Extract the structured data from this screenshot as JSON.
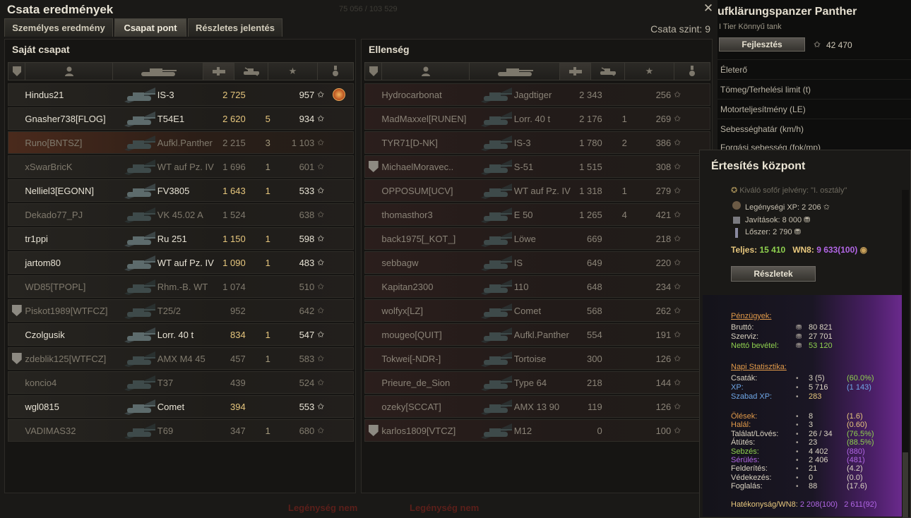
{
  "window": {
    "title": "Csata eredmények",
    "close": "✕",
    "faint_top": "75 056 / 103 529",
    "battle_level": "Csata szint: 9",
    "tabs": [
      {
        "label": "Személyes eredmény"
      },
      {
        "label": "Csapat pont"
      },
      {
        "label": "Részletes jelentés"
      }
    ]
  },
  "own_team": {
    "title": "Saját csapat",
    "rows": [
      {
        "name": "Hindus21",
        "tank": "IS-3",
        "xp": "2 725",
        "kills": "",
        "score": "957",
        "state": "alive",
        "medal": true,
        "squad": false
      },
      {
        "name": "Gnasher738[FLOG]",
        "tank": "T54E1",
        "xp": "2 620",
        "kills": "5",
        "score": "934",
        "state": "alive",
        "medal": false,
        "squad": false
      },
      {
        "name": "Runo[BNTSZ]",
        "tank": "Aufkl.Panther",
        "xp": "2 215",
        "kills": "3",
        "score": "1 103",
        "state": "me",
        "medal": false,
        "squad": false
      },
      {
        "name": "xSwarBricK",
        "tank": "WT auf Pz. IV",
        "xp": "1 696",
        "kills": "1",
        "score": "601",
        "state": "dead",
        "medal": false,
        "squad": false
      },
      {
        "name": "Nelliel3[EGONN]",
        "tank": "FV3805",
        "xp": "1 643",
        "kills": "1",
        "score": "533",
        "state": "alive",
        "medal": false,
        "squad": false
      },
      {
        "name": "Dekado77_PJ",
        "tank": "VK 45.02 A",
        "xp": "1 524",
        "kills": "",
        "score": "638",
        "state": "dead",
        "medal": false,
        "squad": false
      },
      {
        "name": "tr1ppi",
        "tank": "Ru 251",
        "xp": "1 150",
        "kills": "1",
        "score": "598",
        "state": "alive",
        "medal": false,
        "squad": false
      },
      {
        "name": "jartom80",
        "tank": "WT auf Pz. IV",
        "xp": "1 090",
        "kills": "1",
        "score": "483",
        "state": "alive",
        "medal": false,
        "squad": false
      },
      {
        "name": "WD85[TPOPL]",
        "tank": "Rhm.-B. WT",
        "xp": "1 074",
        "kills": "",
        "score": "510",
        "state": "dead",
        "medal": false,
        "squad": false
      },
      {
        "name": "Piskot1989[WTFCZ]",
        "tank": "T25/2",
        "xp": "952",
        "kills": "",
        "score": "642",
        "state": "dead",
        "medal": false,
        "squad": true
      },
      {
        "name": "Czolgusik",
        "tank": "Lorr. 40 t",
        "xp": "834",
        "kills": "1",
        "score": "547",
        "state": "alive",
        "medal": false,
        "squad": false
      },
      {
        "name": "zdeblik125[WTFCZ]",
        "tank": "AMX M4 45",
        "xp": "457",
        "kills": "1",
        "score": "583",
        "state": "dead",
        "medal": false,
        "squad": true
      },
      {
        "name": "koncio4",
        "tank": "T37",
        "xp": "439",
        "kills": "",
        "score": "524",
        "state": "dead",
        "medal": false,
        "squad": false
      },
      {
        "name": "wgl0815",
        "tank": "Comet",
        "xp": "394",
        "kills": "",
        "score": "553",
        "state": "alive",
        "medal": false,
        "squad": false
      },
      {
        "name": "VADIMAS32",
        "tank": "T69",
        "xp": "347",
        "kills": "1",
        "score": "680",
        "state": "dead",
        "medal": false,
        "squad": false
      }
    ]
  },
  "enemy_team": {
    "title": "Ellenség",
    "rows": [
      {
        "name": "Hydrocarbonat",
        "tank": "Jagdtiger",
        "xp": "2 343",
        "kills": "",
        "score": "256",
        "squad": false
      },
      {
        "name": "MadMaxxel[RUNEN]",
        "tank": "Lorr. 40 t",
        "xp": "2 176",
        "kills": "1",
        "score": "269",
        "squad": false
      },
      {
        "name": "TYR71[D-NK]",
        "tank": "IS-3",
        "xp": "1 780",
        "kills": "2",
        "score": "386",
        "squad": false
      },
      {
        "name": "MichaelMoravec..",
        "tank": "S-51",
        "xp": "1 515",
        "kills": "",
        "score": "308",
        "squad": true
      },
      {
        "name": "OPPOSUM[UCV]",
        "tank": "WT auf Pz. IV",
        "xp": "1 318",
        "kills": "1",
        "score": "279",
        "squad": false
      },
      {
        "name": "thomasthor3",
        "tank": "E 50",
        "xp": "1 265",
        "kills": "4",
        "score": "421",
        "squad": false
      },
      {
        "name": "back1975[_KOT_]",
        "tank": "Löwe",
        "xp": "669",
        "kills": "",
        "score": "218",
        "squad": false
      },
      {
        "name": "sebbagw",
        "tank": "IS",
        "xp": "649",
        "kills": "",
        "score": "220",
        "squad": false
      },
      {
        "name": "Kapitan2300",
        "tank": "110",
        "xp": "648",
        "kills": "",
        "score": "234",
        "squad": false
      },
      {
        "name": "wolfyx[LZ]",
        "tank": "Comet",
        "xp": "568",
        "kills": "",
        "score": "262",
        "squad": false
      },
      {
        "name": "mougeo[QUIT]",
        "tank": "Aufkl.Panther",
        "xp": "554",
        "kills": "",
        "score": "191",
        "squad": false
      },
      {
        "name": "Tokwei[-NDR-]",
        "tank": "Tortoise",
        "xp": "300",
        "kills": "",
        "score": "126",
        "squad": false
      },
      {
        "name": "Prieure_de_Sion",
        "tank": "Type 64",
        "xp": "218",
        "kills": "",
        "score": "144",
        "squad": false
      },
      {
        "name": "ozeky[SCCAT]",
        "tank": "AMX 13 90",
        "xp": "119",
        "kills": "",
        "score": "126",
        "squad": false
      },
      {
        "name": "karlos1809[VTCZ]",
        "tank": "M12",
        "xp": "0",
        "kills": "",
        "score": "100",
        "squad": true
      }
    ]
  },
  "bottom_ghost": [
    "Legénység nem",
    "Legénység nem"
  ],
  "tank_info": {
    "title": "ufklärungspanzer Panther",
    "subtitle": "I Tier Könnyű tank",
    "upgrade_button": "Fejlesztés",
    "xp_value": "42 470",
    "stats": [
      "Életerő",
      "Tömeg/Terhelési limit (t)",
      "Motorteljesítmény (LE)",
      "Sebességhatár (km/h)",
      "Forgási sebesség (fok/mp)"
    ]
  },
  "notification_center": {
    "title": "Értesítés központ",
    "faint_line": "Kiváló sofőr jelvény: \"I. osztály\"",
    "crew_xp": "Legénységi XP: 2 206",
    "repairs": "Javítások: 8 000",
    "ammo": "Lőszer: 2 790",
    "total_label": "Teljes:",
    "total_value": "15 410",
    "wn8_label": "WN8:",
    "wn8_value": "9 633",
    "wn8_pct": "(100)",
    "details_button": "Részletek",
    "finances": {
      "title": "Pénzügyek:",
      "rows": [
        {
          "label": "Bruttó:",
          "value": "80 821"
        },
        {
          "label": "Szerviz:",
          "value": "27 701"
        },
        {
          "label": "Nettó bevétel:",
          "value": "53 120"
        }
      ]
    },
    "daily": {
      "title": "Napi Statisztika:",
      "rows": [
        {
          "label": "Csaták:",
          "value": "3 (5)",
          "pct": "(60.0%)"
        },
        {
          "label": "XP:",
          "value": "5 716",
          "pct": "(1 143)"
        },
        {
          "label": "Szabad XP:",
          "value": "283",
          "pct": ""
        }
      ]
    },
    "combat": {
      "rows": [
        {
          "label": "Ölések:",
          "value": "8",
          "pct": "(1.6)"
        },
        {
          "label": "Halál:",
          "value": "3",
          "pct": "(0.60)"
        },
        {
          "label": "Találat/Lövés:",
          "value": "26 / 34",
          "pct": "(76.5%)"
        },
        {
          "label": "Átütés:",
          "value": "23",
          "pct": "(88.5%)"
        },
        {
          "label": "Sebzés:",
          "value": "4 402",
          "pct": "(880)"
        },
        {
          "label": "Sérülés:",
          "value": "2 406",
          "pct": "(481)"
        },
        {
          "label": "Felderítés:",
          "value": "21",
          "pct": "(4.2)"
        },
        {
          "label": "Védekezés:",
          "value": "0",
          "pct": "(0.0)"
        },
        {
          "label": "Foglalás:",
          "value": "88",
          "pct": "(17.6)"
        }
      ]
    },
    "efficiency": {
      "label": "Hatékonyság/WN8:",
      "eff": "2 208",
      "eff_pct": "(100)",
      "wn8": "2 611",
      "wn8_pct": "(92)"
    }
  },
  "colors": {
    "gold": "#e7c77d",
    "green": "#8fd14f",
    "purple": "#b266e6",
    "orange": "#e19a4a",
    "blue": "#6fa6e6"
  }
}
